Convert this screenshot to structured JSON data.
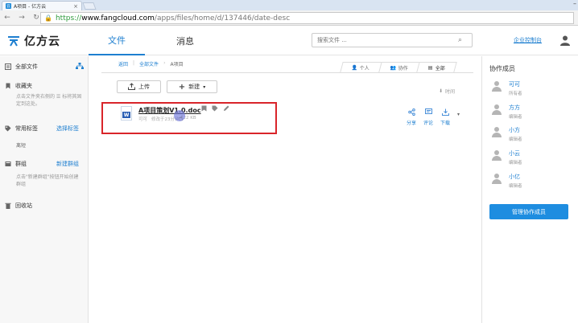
{
  "browser": {
    "tab_title": "A项目 - 亿方云",
    "url_scheme": "https://",
    "url_host": "www.fangcloud.com",
    "url_path": "/apps/files/home/d/137446/date-desc"
  },
  "header": {
    "logo_text": "亿方云",
    "nav_files": "文件",
    "nav_messages": "消息",
    "search_placeholder": "搜索文件 ...",
    "console_link": "企业控制台"
  },
  "sidebar": {
    "all_files": "全部文件",
    "favorites": "收藏夹",
    "favorites_hint": "点击文件夹右侧的 ☰ 标将其固定到这处。",
    "common_tags": "常用标签",
    "select_tags": "选择标签",
    "tag_item": "离短",
    "groups": "群组",
    "new_group": "新建群组",
    "groups_hint": "点击\"新建群组\"按钮开始创建群组",
    "recycle_bin": "回收站"
  },
  "breadcrumb": {
    "back": "返回",
    "all_files": "全部文件",
    "current": "A项目"
  },
  "view_tabs": {
    "personal": "个人",
    "collab": "协作",
    "all": "全部"
  },
  "toolbar": {
    "upload": "上传",
    "new": "新建",
    "sort_time": "时间"
  },
  "file": {
    "name": "A项目策划V1.0.doc",
    "owner": "可可",
    "modified": "修改于23分钟",
    "size": "22 KB",
    "actions": {
      "share": "分享",
      "comment": "评论",
      "download": "下载"
    }
  },
  "right_panel": {
    "title": "协作成员",
    "members": [
      {
        "name": "可可",
        "role": "所有者"
      },
      {
        "name": "方方",
        "role": "编辑者"
      },
      {
        "name": "小方",
        "role": "编辑者"
      },
      {
        "name": "小云",
        "role": "编辑者"
      },
      {
        "name": "小亿",
        "role": "编辑者"
      }
    ],
    "manage_button": "管理协作成员"
  },
  "colors": {
    "accent": "#1e7fd0",
    "highlight_border": "#d9252a",
    "button_blue": "#1e8de0"
  }
}
